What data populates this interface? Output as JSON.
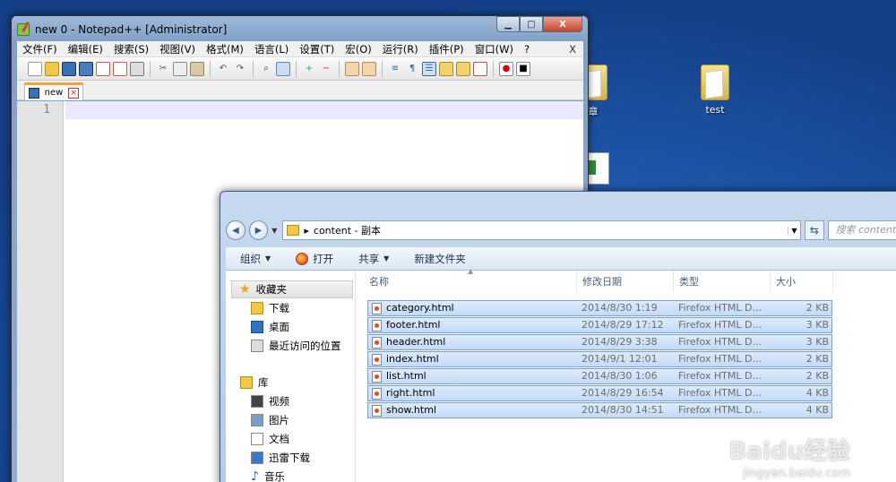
{
  "desktop": {
    "icons": [
      {
        "label": "章"
      },
      {
        "label": "test"
      }
    ]
  },
  "notepad": {
    "title": "new  0 - Notepad++ [Administrator]",
    "window_buttons": {
      "minimize": "▁",
      "maximize": "□",
      "close": "X"
    },
    "menu": [
      "文件(F)",
      "编辑(E)",
      "搜索(S)",
      "视图(V)",
      "格式(M)",
      "语言(L)",
      "设置(T)",
      "宏(O)",
      "运行(R)",
      "插件(P)",
      "窗口(W)",
      "?"
    ],
    "menu_close": "X",
    "tab_label": "new",
    "line_number": "1"
  },
  "explorer": {
    "breadcrumb_separator": "▸",
    "address": "content - 副本",
    "search_placeholder": "搜索 content",
    "commands": {
      "organize": "组织",
      "open": "打开",
      "share": "共享",
      "new_folder": "新建文件夹"
    },
    "nav": {
      "favorites": "收藏夹",
      "downloads": "下载",
      "desktop": "桌面",
      "recent": "最近访问的位置",
      "libraries": "库",
      "videos": "视频",
      "pictures": "图片",
      "documents": "文档",
      "thunder": "迅雷下载",
      "music": "音乐"
    },
    "columns": {
      "name": "名称",
      "date": "修改日期",
      "type": "类型",
      "size": "大小"
    },
    "files": [
      {
        "name": "category.html",
        "date": "2014/8/30 1:19",
        "type": "Firefox HTML D...",
        "size": "2 KB"
      },
      {
        "name": "footer.html",
        "date": "2014/8/29 17:12",
        "type": "Firefox HTML D...",
        "size": "3 KB"
      },
      {
        "name": "header.html",
        "date": "2014/8/29 3:38",
        "type": "Firefox HTML D...",
        "size": "3 KB"
      },
      {
        "name": "index.html",
        "date": "2014/9/1 12:01",
        "type": "Firefox HTML D...",
        "size": "2 KB"
      },
      {
        "name": "list.html",
        "date": "2014/8/30 1:06",
        "type": "Firefox HTML D...",
        "size": "2 KB"
      },
      {
        "name": "right.html",
        "date": "2014/8/29 16:54",
        "type": "Firefox HTML D...",
        "size": "4 KB"
      },
      {
        "name": "show.html",
        "date": "2014/8/30 14:51",
        "type": "Firefox HTML D...",
        "size": "4 KB"
      }
    ]
  },
  "watermark": {
    "text": "Baidu经验",
    "url": "jingyan.baidu.com"
  }
}
